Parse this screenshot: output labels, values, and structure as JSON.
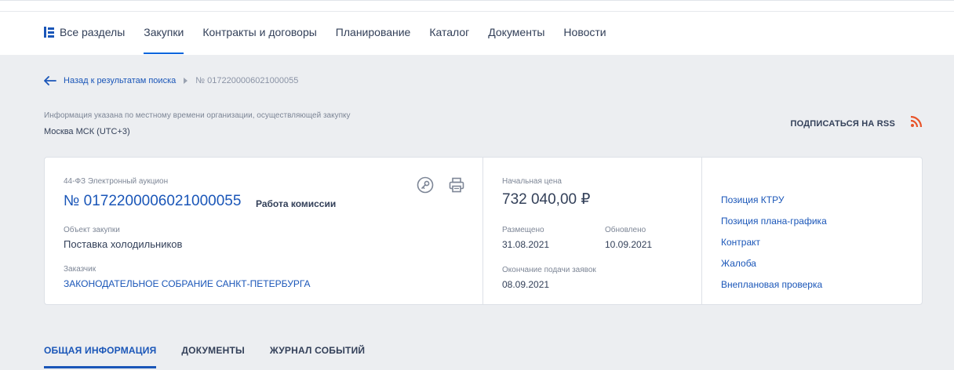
{
  "nav": {
    "items": [
      {
        "label": "Все разделы",
        "icon": "sections-icon"
      },
      {
        "label": "Закупки",
        "active": true
      },
      {
        "label": "Контракты и договоры"
      },
      {
        "label": "Планирование"
      },
      {
        "label": "Каталог"
      },
      {
        "label": "Документы"
      },
      {
        "label": "Новости"
      }
    ]
  },
  "breadcrumb": {
    "back_label": "Назад к результатам поиска",
    "current": "№ 0172200006021000055"
  },
  "timezone": {
    "note": "Информация указана по местному времени организации, осуществляющей закупку",
    "value": "Москва МСК (UTC+3)"
  },
  "rss": {
    "label": "ПОДПИСАТЬСЯ НА RSS"
  },
  "card": {
    "procedure_type": "44-ФЗ Электронный аукцион",
    "number": "№ 0172200006021000055",
    "stage": "Работа комиссии",
    "object_label": "Объект закупки",
    "object_value": "Поставка холодильников",
    "customer_label": "Заказчик",
    "customer_value": "ЗАКОНОДАТЕЛЬНОЕ СОБРАНИЕ САНКТ-ПЕТЕРБУРГА",
    "price_label": "Начальная цена",
    "price_value": "732 040,00 ₽",
    "placed_label": "Размещено",
    "placed_value": "31.08.2021",
    "updated_label": "Обновлено",
    "updated_value": "10.09.2021",
    "deadline_label": "Окончание подачи заявок",
    "deadline_value": "08.09.2021",
    "links": [
      "Позиция КТРУ",
      "Позиция плана-графика",
      "Контракт",
      "Жалоба",
      "Внеплановая проверка"
    ]
  },
  "tabs": [
    {
      "label": "ОБЩАЯ ИНФОРМАЦИЯ",
      "active": true
    },
    {
      "label": "ДОКУМЕНТЫ"
    },
    {
      "label": "ЖУРНАЛ СОБЫТИЙ"
    }
  ],
  "colors": {
    "accent": "#1a56b8",
    "nav_underline": "#0065dd",
    "rss": "#e8542a",
    "background": "#eceef1"
  }
}
